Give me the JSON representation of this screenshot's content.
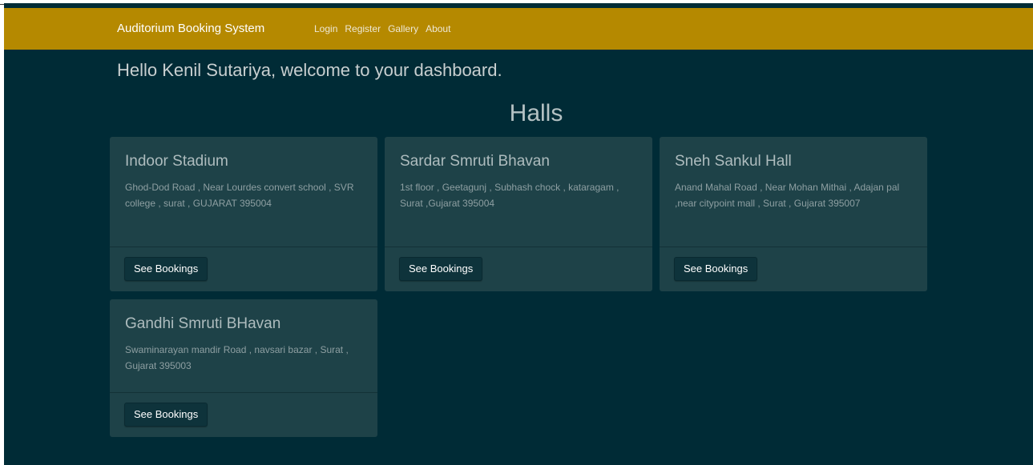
{
  "navbar": {
    "brand": "Auditorium Booking System",
    "links": [
      "Login",
      "Register",
      "Gallery",
      "About"
    ]
  },
  "welcome": "Hello Kenil Sutariya, welcome to your dashboard.",
  "halls_heading": "Halls",
  "halls": [
    {
      "name": "Indoor Stadium",
      "address": "Ghod-Dod Road , Near Lourdes convert school , SVR college , surat , GUJARAT 395004",
      "button": "See Bookings"
    },
    {
      "name": "Sardar Smruti Bhavan",
      "address": "1st floor , Geetagunj , Subhash chock , kataragam , Surat ,Gujarat 395004",
      "button": "See Bookings"
    },
    {
      "name": "Sneh Sankul Hall",
      "address": "Anand Mahal Road , Near Mohan Mithai , Adajan pal ,near citypoint mall , Surat , Gujarat 395007",
      "button": "See Bookings"
    },
    {
      "name": "Gandhi Smruti BHavan",
      "address": "Swaminarayan mandir Road , navsari bazar , Surat , Gujarat 395003",
      "button": "See Bookings"
    }
  ],
  "colors": {
    "navbar": "#b58900",
    "background": "#002b36",
    "card": "#1e4248",
    "button": "#0e333b"
  }
}
